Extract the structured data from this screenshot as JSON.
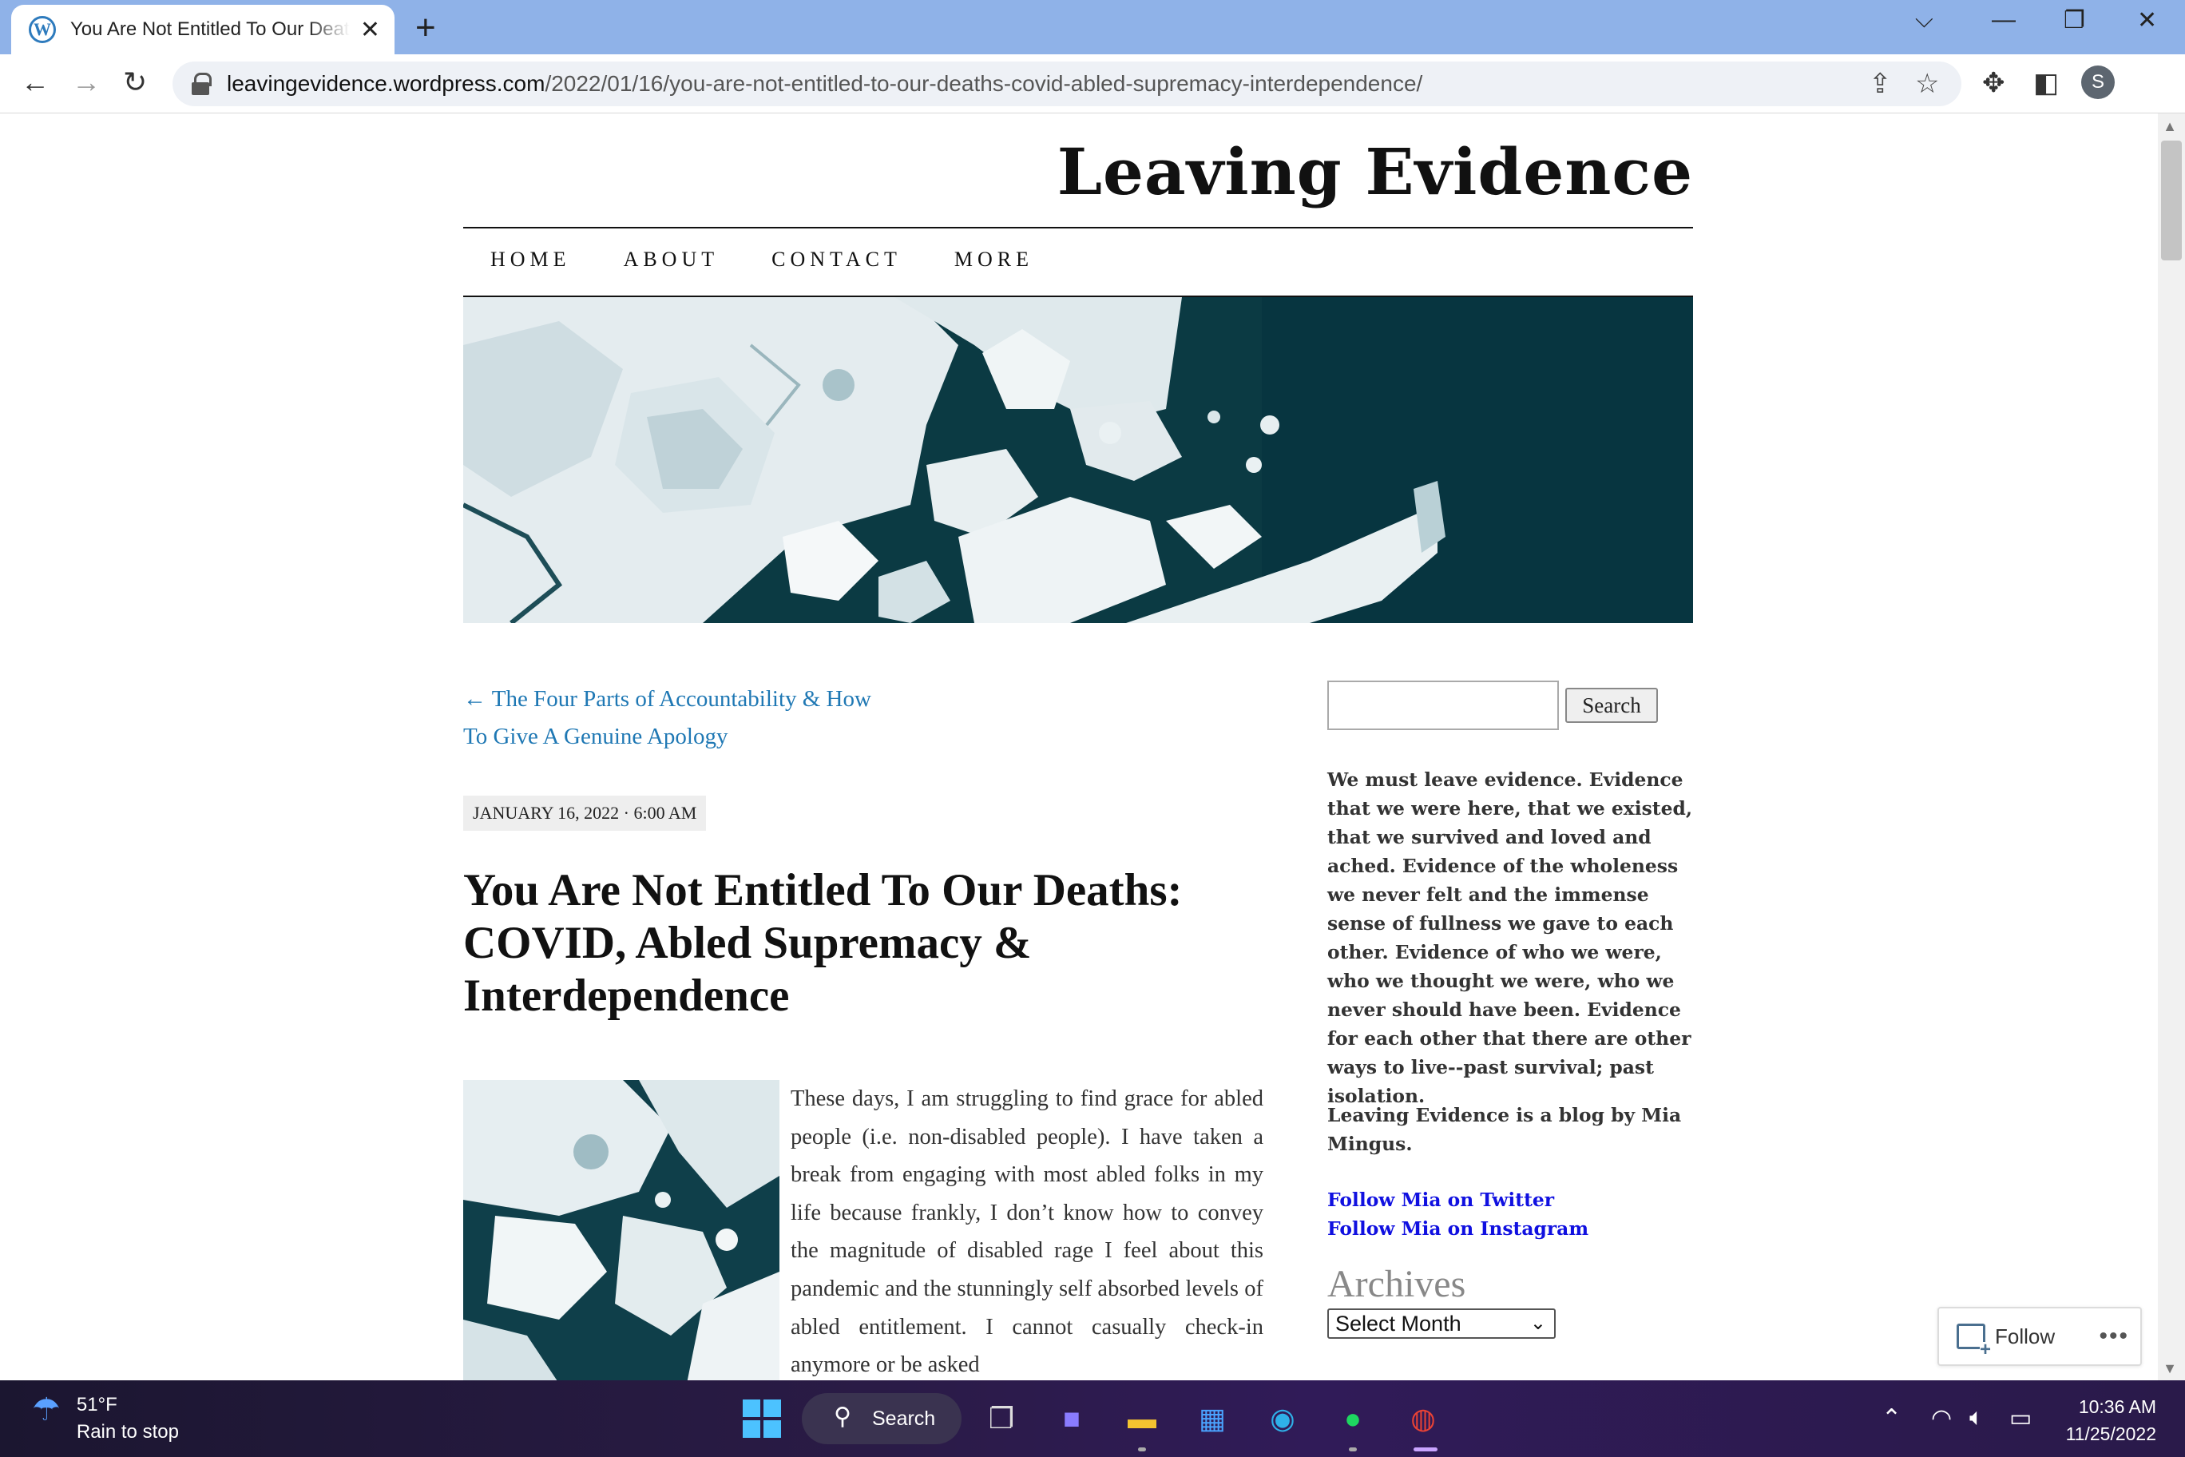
{
  "browser": {
    "tab_title": "You Are Not Entitled To Our Deaths: COVID, Abled Supremacy & Interdependence",
    "favicon_letter": "W",
    "url_host": "leavingevidence.wordpress.com",
    "url_path": "/2022/01/16/you-are-not-entitled-to-our-deaths-covid-abled-supremacy-interdependence/",
    "profile_initial": "S"
  },
  "site": {
    "title": "Leaving Evidence",
    "nav": [
      "HOME",
      "ABOUT",
      "CONTACT",
      "MORE"
    ]
  },
  "post": {
    "prev_link": "← The Four Parts of Accountability & How To Give A Genuine Apology",
    "date": "JANUARY 16, 2022 · 6:00 AM",
    "title": "You Are Not Entitled To Our Deaths: COVID, Abled Supremacy & Interdependence",
    "body": "These days, I am struggling to find grace for abled people (i.e. non-disabled people). I have taken a break from engaging with most abled folks in my life because frankly, I don’t know how to convey the magnitude of disabled rage I feel about this pandemic and the stunningly self absorbed levels of abled entitlement. I cannot casually check-in anymore or be asked"
  },
  "sidebar": {
    "search_placeholder": "",
    "search_button": "Search",
    "intro": "We must leave evidence. Evidence that we were here, that we existed, that we survived and loved and ached. Evidence of the wholeness we never felt and the immense sense of fullness we gave to each other. Evidence of who we were, who we thought we were, who we never should have been. Evidence for each other that there are other ways to live--past survival; past isolation.",
    "byline": "Leaving Evidence is a blog by Mia Mingus.",
    "links": [
      "Follow Mia on Twitter",
      "Follow Mia on Instagram"
    ],
    "archives_title": "Archives",
    "archives_select": "Select Month"
  },
  "follow": {
    "label": "Follow",
    "more": "•••"
  },
  "taskbar": {
    "temperature": "51°F",
    "weather": "Rain to stop",
    "search_label": "Search",
    "time": "10:36 AM",
    "date": "11/25/2022"
  },
  "colors": {
    "tabbar": "#8fb2e8",
    "link": "#1f78b4",
    "sidebar_link": "#1010e0",
    "ice_water": "#0b3a43"
  }
}
